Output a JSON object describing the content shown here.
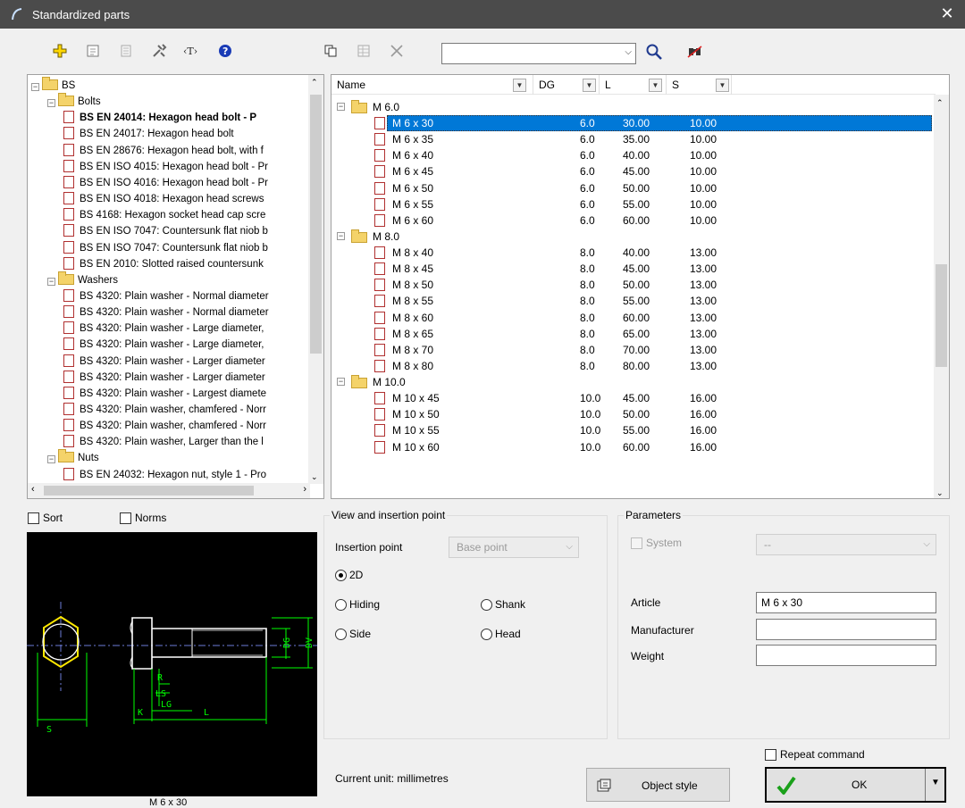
{
  "window": {
    "title": "Standardized parts",
    "close_glyph": "✕"
  },
  "toolbar": {
    "search_value": ""
  },
  "tree": {
    "rows": [
      {
        "label": "BS",
        "kind": "folder",
        "indent": 0
      },
      {
        "label": "Bolts",
        "kind": "folder",
        "indent": 1
      },
      {
        "label": "BS EN 24014: Hexagon head bolt - P",
        "kind": "doc",
        "indent": 2,
        "bold": true
      },
      {
        "label": "BS EN 24017: Hexagon head bolt",
        "kind": "doc",
        "indent": 2
      },
      {
        "label": "BS EN 28676: Hexagon head bolt, with f",
        "kind": "doc",
        "indent": 2
      },
      {
        "label": "BS EN ISO 4015: Hexagon head bolt - Pr",
        "kind": "doc",
        "indent": 2
      },
      {
        "label": "BS EN ISO 4016: Hexagon head bolt - Pr",
        "kind": "doc",
        "indent": 2
      },
      {
        "label": "BS EN ISO 4018: Hexagon head screws",
        "kind": "doc",
        "indent": 2
      },
      {
        "label": "BS 4168: Hexagon socket head cap scre",
        "kind": "doc",
        "indent": 2
      },
      {
        "label": "BS EN ISO 7047: Countersunk flat niob b",
        "kind": "doc",
        "indent": 2
      },
      {
        "label": "BS EN ISO 7047: Countersunk flat niob b",
        "kind": "doc",
        "indent": 2
      },
      {
        "label": "BS EN 2010: Slotted raised countersunk",
        "kind": "doc",
        "indent": 2
      },
      {
        "label": "Washers",
        "kind": "folder",
        "indent": 1
      },
      {
        "label": "BS 4320: Plain washer - Normal diameter",
        "kind": "doc",
        "indent": 2
      },
      {
        "label": "BS 4320: Plain washer - Normal diameter",
        "kind": "doc",
        "indent": 2
      },
      {
        "label": "BS 4320: Plain washer - Large diameter,",
        "kind": "doc",
        "indent": 2
      },
      {
        "label": "BS 4320: Plain washer - Large diameter,",
        "kind": "doc",
        "indent": 2
      },
      {
        "label": "BS 4320: Plain washer - Larger diameter",
        "kind": "doc",
        "indent": 2
      },
      {
        "label": "BS 4320: Plain washer - Larger diameter",
        "kind": "doc",
        "indent": 2
      },
      {
        "label": "BS 4320: Plain washer - Largest diamete",
        "kind": "doc",
        "indent": 2
      },
      {
        "label": "BS 4320: Plain washer, chamfered - Norr",
        "kind": "doc",
        "indent": 2
      },
      {
        "label": "BS 4320: Plain washer, chamfered - Norr",
        "kind": "doc",
        "indent": 2
      },
      {
        "label": "BS 4320: Plain washer, Larger than the l",
        "kind": "doc",
        "indent": 2
      },
      {
        "label": "Nuts",
        "kind": "folder",
        "indent": 1
      },
      {
        "label": "BS EN 24032: Hexagon nut, style 1 - Pro",
        "kind": "doc",
        "indent": 2
      }
    ]
  },
  "list": {
    "headers": {
      "name": "Name",
      "dg": "DG",
      "l": "L",
      "s": "S"
    },
    "rows": [
      {
        "type": "group",
        "name": "M 6.0"
      },
      {
        "type": "item",
        "name": "M 6 x 30",
        "dg": "6.0",
        "l": "30.00",
        "s": "10.00",
        "selected": true
      },
      {
        "type": "item",
        "name": "M 6 x 35",
        "dg": "6.0",
        "l": "35.00",
        "s": "10.00"
      },
      {
        "type": "item",
        "name": "M 6 x 40",
        "dg": "6.0",
        "l": "40.00",
        "s": "10.00"
      },
      {
        "type": "item",
        "name": "M 6 x 45",
        "dg": "6.0",
        "l": "45.00",
        "s": "10.00"
      },
      {
        "type": "item",
        "name": "M 6 x 50",
        "dg": "6.0",
        "l": "50.00",
        "s": "10.00"
      },
      {
        "type": "item",
        "name": "M 6 x 55",
        "dg": "6.0",
        "l": "55.00",
        "s": "10.00"
      },
      {
        "type": "item",
        "name": "M 6 x 60",
        "dg": "6.0",
        "l": "60.00",
        "s": "10.00"
      },
      {
        "type": "group",
        "name": "M 8.0"
      },
      {
        "type": "item",
        "name": "M 8 x 40",
        "dg": "8.0",
        "l": "40.00",
        "s": "13.00"
      },
      {
        "type": "item",
        "name": "M 8 x 45",
        "dg": "8.0",
        "l": "45.00",
        "s": "13.00"
      },
      {
        "type": "item",
        "name": "M 8 x 50",
        "dg": "8.0",
        "l": "50.00",
        "s": "13.00"
      },
      {
        "type": "item",
        "name": "M 8 x 55",
        "dg": "8.0",
        "l": "55.00",
        "s": "13.00"
      },
      {
        "type": "item",
        "name": "M 8 x 60",
        "dg": "8.0",
        "l": "60.00",
        "s": "13.00"
      },
      {
        "type": "item",
        "name": "M 8 x 65",
        "dg": "8.0",
        "l": "65.00",
        "s": "13.00"
      },
      {
        "type": "item",
        "name": "M 8 x 70",
        "dg": "8.0",
        "l": "70.00",
        "s": "13.00"
      },
      {
        "type": "item",
        "name": "M 8 x 80",
        "dg": "8.0",
        "l": "80.00",
        "s": "13.00"
      },
      {
        "type": "group",
        "name": "M 10.0"
      },
      {
        "type": "item",
        "name": "M 10 x 45",
        "dg": "10.0",
        "l": "45.00",
        "s": "16.00"
      },
      {
        "type": "item",
        "name": "M 10 x 50",
        "dg": "10.0",
        "l": "50.00",
        "s": "16.00"
      },
      {
        "type": "item",
        "name": "M 10 x 55",
        "dg": "10.0",
        "l": "55.00",
        "s": "16.00"
      },
      {
        "type": "item",
        "name": "M 10 x 60",
        "dg": "10.0",
        "l": "60.00",
        "s": "16.00"
      }
    ]
  },
  "options": {
    "sort": "Sort",
    "norms": "Norms"
  },
  "preview": {
    "caption": "M 6 x 30",
    "dim_labels": {
      "s": "S",
      "k": "K",
      "l": "L",
      "lg": "LG",
      "ls": "LS",
      "r": "R",
      "dg": "DG",
      "dv": "DV"
    }
  },
  "view": {
    "title": "View and insertion point",
    "insertion_label": "Insertion point",
    "insertion_value": "Base point",
    "r2d": "2D",
    "hiding": "Hiding",
    "shank": "Shank",
    "side": "Side",
    "head": "Head",
    "unit": "Current unit: millimetres"
  },
  "params": {
    "title": "Parameters",
    "system": "System",
    "system_value": "--",
    "article_label": "Article",
    "article_value": "M 6 x 30",
    "manufacturer_label": "Manufacturer",
    "manufacturer_value": "",
    "weight_label": "Weight",
    "weight_value": ""
  },
  "footer": {
    "repeat": "Repeat command",
    "object_style": "Object style",
    "ok": "OK"
  }
}
